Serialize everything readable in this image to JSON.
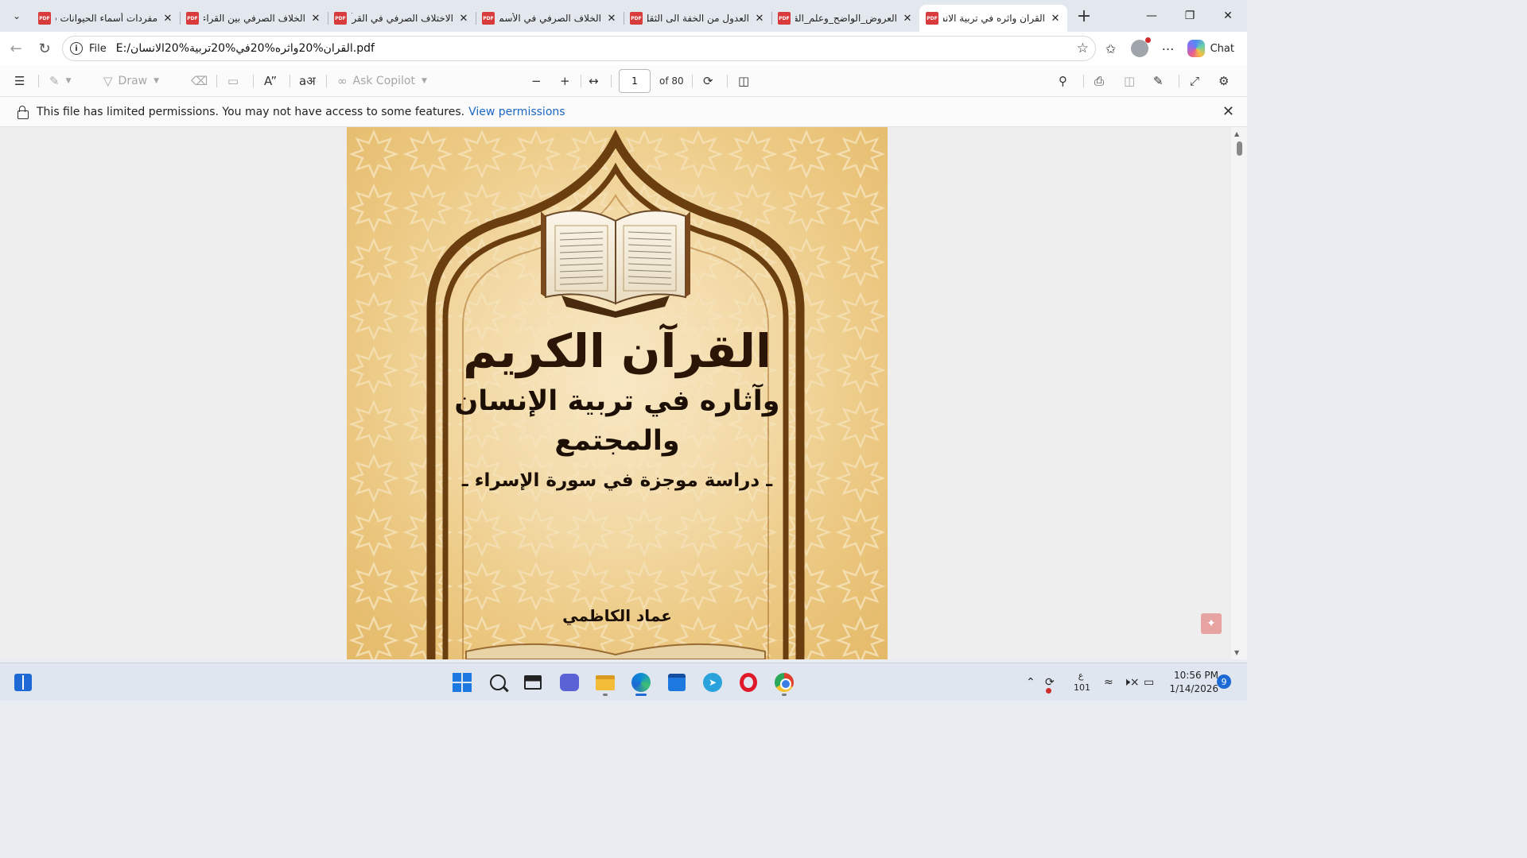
{
  "tabs": [
    {
      "title": "مفردات أسماء الحيوانات في",
      "active": false
    },
    {
      "title": "الخلاف الصرفي بين القراء",
      "active": false
    },
    {
      "title": "الاختلاف الصرفي في القرآن",
      "active": false
    },
    {
      "title": "الخلاف الصرفي في الأسماء",
      "active": false
    },
    {
      "title": "العدول من الخفة الى الثقل",
      "active": false
    },
    {
      "title": "العروض_الواضح_وعلم_القافية",
      "active": false
    },
    {
      "title": "القران واثره في تربية الانسان",
      "active": true
    }
  ],
  "address": {
    "scheme_label": "File",
    "url": "E:/القران%20واثره%20في%20تربية%20الانسان.pdf"
  },
  "addr_actions": {
    "chat_label": "Chat"
  },
  "pdf_toolbar": {
    "draw_label": "Draw",
    "ask_copilot_label": "Ask Copilot",
    "page_value": "1",
    "page_total": "of 80"
  },
  "infobar": {
    "message": "This file has limited permissions. You may not have access to some features.",
    "link": "View permissions"
  },
  "cover": {
    "title": "القرآن الكريم",
    "subtitle_1": "وآثاره في تربية الإنسان",
    "subtitle_2": "والمجتمع",
    "subtitle_3": "ـ دراسة موجزة في سورة الإسراء ـ",
    "author": "عماد الكاظمي"
  },
  "taskbar": {
    "lang_line1": "ع",
    "lang_line2": "101",
    "time": "10:56 PM",
    "date": "1/14/2026",
    "notifications": "9"
  },
  "icons": {
    "tab_menu": "chevron-down-icon",
    "pdf": "pdf-file-icon",
    "back": "arrow-left-icon",
    "refresh": "refresh-icon",
    "favorites": "star-icon"
  },
  "colors": {
    "accent": "#1a66c2",
    "pdf_red": "#d83b3b",
    "cover_brown": "#6b3e10"
  }
}
